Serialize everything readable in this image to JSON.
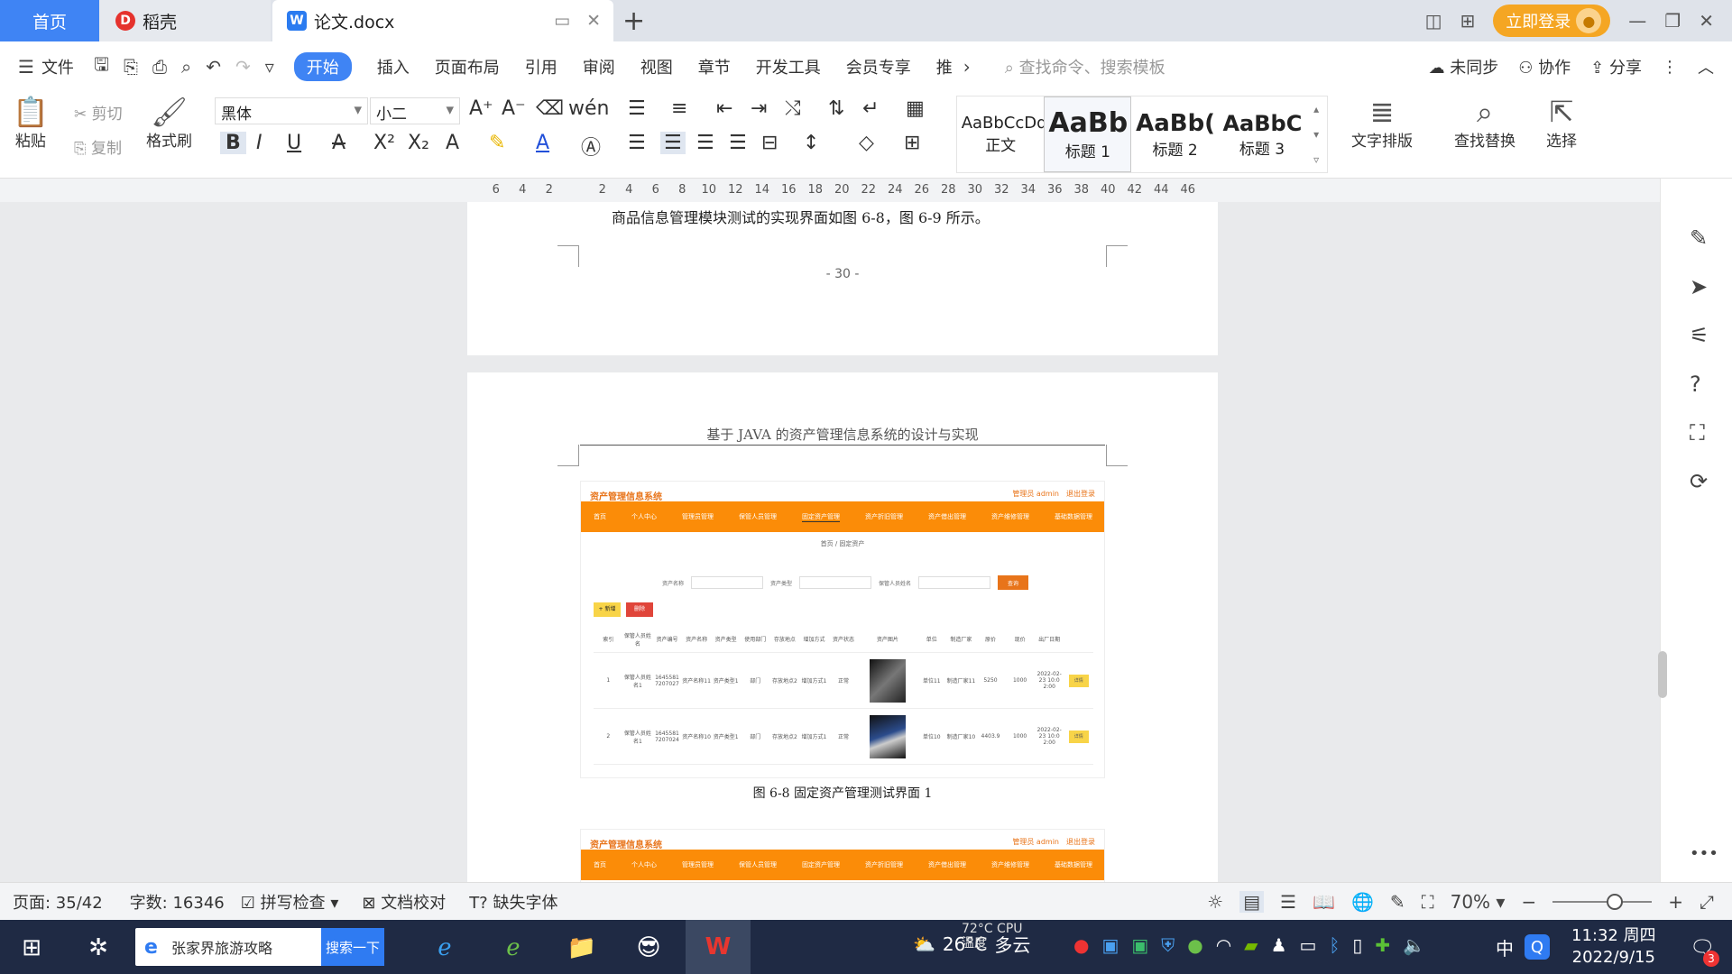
{
  "tabs": {
    "home": "首页",
    "daoke": "稻壳",
    "doc": "论文.docx",
    "add": "+"
  },
  "window": {
    "login": "立即登录"
  },
  "menu": {
    "file": "文件",
    "items": [
      "开始",
      "插入",
      "页面布局",
      "引用",
      "审阅",
      "视图",
      "章节",
      "开发工具",
      "会员专享",
      "推"
    ],
    "search_placeholder": "查找命令、搜索模板",
    "sync": "未同步",
    "collab": "协作",
    "share": "分享"
  },
  "ribbon": {
    "paste": "粘贴",
    "cut": "剪切",
    "copy": "复制",
    "format_painter": "格式刷",
    "font_name": "黑体",
    "font_size": "小二",
    "styles": [
      {
        "preview": "AaBbCcDd",
        "name": "正文"
      },
      {
        "preview": "AaBb",
        "name": "标题 1"
      },
      {
        "preview": "AaBb(",
        "name": "标题 2"
      },
      {
        "preview": "AaBbC",
        "name": "标题 3"
      }
    ],
    "text_layout": "文字排版",
    "find_replace": "查找替换",
    "select": "选择"
  },
  "ruler": {
    "numbers": [
      "6",
      "4",
      "2",
      "",
      "2",
      "4",
      "6",
      "8",
      "10",
      "12",
      "14",
      "16",
      "18",
      "20",
      "22",
      "24",
      "26",
      "28",
      "30",
      "32",
      "34",
      "36",
      "38",
      "40",
      "42",
      "44",
      "46"
    ]
  },
  "document": {
    "body_text": "商品信息管理模块测试的实现界面如图 6-8，图 6-9 所示。",
    "page_number": "- 30 -",
    "running_header": "基于 JAVA 的资产管理信息系统的设计与实现",
    "figure_caption": "图 6-8 固定资产管理测试界面 1",
    "screenshot": {
      "title": "资产管理信息系统",
      "user": "管理员 admin　退出登录",
      "nav": [
        "首页",
        "个人中心",
        "管理员管理",
        "保管人员管理",
        "固定资产管理",
        "资产折旧管理",
        "资产借出管理",
        "资产维修管理",
        "基础数据管理"
      ],
      "breadcrumb": "首页 / 固定资产",
      "filter_labels": [
        "资产名称",
        "资产类型",
        "保管人员姓名"
      ],
      "query_btn": "查询",
      "add_btn": "+ 新增",
      "delete_btn": "删除",
      "headers": [
        "索引",
        "保管人员姓名",
        "资产编号",
        "资产名称",
        "资产类型",
        "使用部门",
        "存放地点",
        "增加方式",
        "资产状态",
        "资产图片",
        "单位",
        "制造厂家",
        "原价",
        "现价",
        "出厂日期",
        ""
      ],
      "rows": [
        [
          "1",
          "保管人员姓名1",
          "1645581 7207027",
          "资产名称11",
          "资产类型1",
          "部门",
          "存放地点2",
          "增加方式1",
          "正常",
          "",
          "单位11",
          "制造厂家11",
          "5250",
          "1000",
          "2022-02-23 10:0 2:00",
          "详情"
        ],
        [
          "2",
          "保管人员姓名1",
          "1645581 7207024",
          "资产名称10",
          "资产类型1",
          "部门",
          "存放地点2",
          "增加方式1",
          "正常",
          "",
          "单位10",
          "制造厂家10",
          "4403.9",
          "1000",
          "2022-02-23 10:0 2:00",
          "详情"
        ]
      ]
    }
  },
  "status": {
    "page": "页面: 35/42",
    "words": "字数: 16346",
    "spellcheck": "拼写检查",
    "proofread": "文档校对",
    "missing_fonts": "缺失字体",
    "zoom": "70%"
  },
  "taskbar": {
    "search_text": "张家界旅游攻略",
    "search_btn": "搜索一下",
    "temp": "26°C",
    "weather": "多云",
    "cpu": "72°C CPU温度",
    "lang": "中",
    "time": "11:32 周四",
    "date": "2022/9/15",
    "notif_count": "3"
  },
  "colors": {
    "accent": "#3f84f4",
    "orange": "#fb8c08",
    "taskbar": "#1f2a44"
  }
}
